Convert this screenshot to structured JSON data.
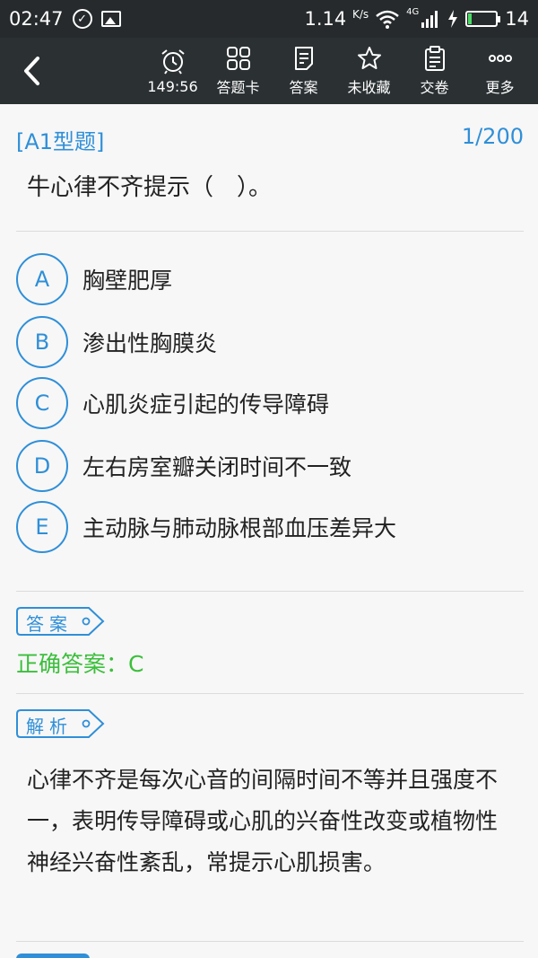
{
  "status_bar": {
    "time": "02:47",
    "net_speed": "1.14",
    "net_unit": "K/s",
    "network_type": "4G",
    "battery_level": "14",
    "battery_fraction": 0.14,
    "icons": [
      "check-circle-icon",
      "image-icon",
      "wifi-icon",
      "signal-icon",
      "charging-icon",
      "battery-icon"
    ]
  },
  "toolbar": {
    "items": [
      {
        "label": "149:56",
        "icon": "alarm-clock-icon"
      },
      {
        "label": "答题卡",
        "icon": "grid-icon"
      },
      {
        "label": "答案",
        "icon": "document-icon"
      },
      {
        "label": "未收藏",
        "icon": "star-icon"
      },
      {
        "label": "交卷",
        "icon": "clipboard-icon"
      },
      {
        "label": "更多",
        "icon": "more-dots-icon"
      }
    ]
  },
  "question": {
    "type": "[A1型题]",
    "progress": "1/200",
    "text": "牛心律不齐提示（　）。"
  },
  "options": [
    {
      "letter": "A",
      "text": "胸壁肥厚"
    },
    {
      "letter": "B",
      "text": "渗出性胸膜炎"
    },
    {
      "letter": "C",
      "text": "心肌炎症引起的传导障碍"
    },
    {
      "letter": "D",
      "text": "左右房室瓣关闭时间不一致"
    },
    {
      "letter": "E",
      "text": "主动脉与肺动脉根部血压差异大"
    }
  ],
  "answer": {
    "tag": "答案",
    "correct": "正确答案：C"
  },
  "analysis": {
    "tag": "解析",
    "text": "心律不齐是每次心音的间隔时间不等并且强度不一，表明传导障碍或心肌的兴奋性改变或植物性神经兴奋性紊乱，常提示心肌损害。"
  },
  "colors": {
    "accent": "#2f8fd8",
    "correct": "#3bbf3b",
    "toolbar_bg": "#2b3033",
    "statusbar_bg": "#262a2c"
  }
}
